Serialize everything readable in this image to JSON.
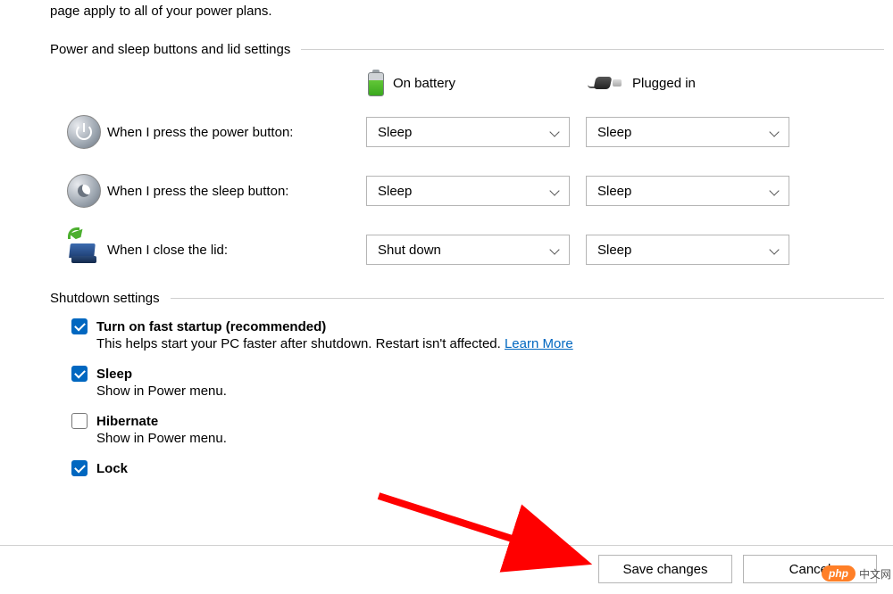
{
  "intro_text": "page apply to all of your power plans.",
  "sections": {
    "buttons_lid": {
      "title": "Power and sleep buttons and lid settings",
      "col_battery": "On battery",
      "col_plugged": "Plugged in",
      "rows": [
        {
          "label": "When I press the power button:",
          "battery": "Sleep",
          "plugged": "Sleep"
        },
        {
          "label": "When I press the sleep button:",
          "battery": "Sleep",
          "plugged": "Sleep"
        },
        {
          "label": "When I close the lid:",
          "battery": "Shut down",
          "plugged": "Sleep"
        }
      ]
    },
    "shutdown": {
      "title": "Shutdown settings",
      "items": [
        {
          "checked": true,
          "label": "Turn on fast startup (recommended)",
          "desc": "This helps start your PC faster after shutdown. Restart isn't affected. ",
          "link": "Learn More"
        },
        {
          "checked": true,
          "label": "Sleep",
          "desc": "Show in Power menu."
        },
        {
          "checked": false,
          "label": "Hibernate",
          "desc": "Show in Power menu."
        },
        {
          "checked": true,
          "label": "Lock",
          "desc": ""
        }
      ]
    }
  },
  "footer": {
    "save": "Save changes",
    "cancel": "Cancel"
  },
  "watermark": {
    "badge": "php",
    "text": "中文网"
  },
  "colors": {
    "accent": "#0067c0",
    "link": "#0067c0",
    "arrow": "#ff0000",
    "watermark_badge": "#ff7f27"
  }
}
